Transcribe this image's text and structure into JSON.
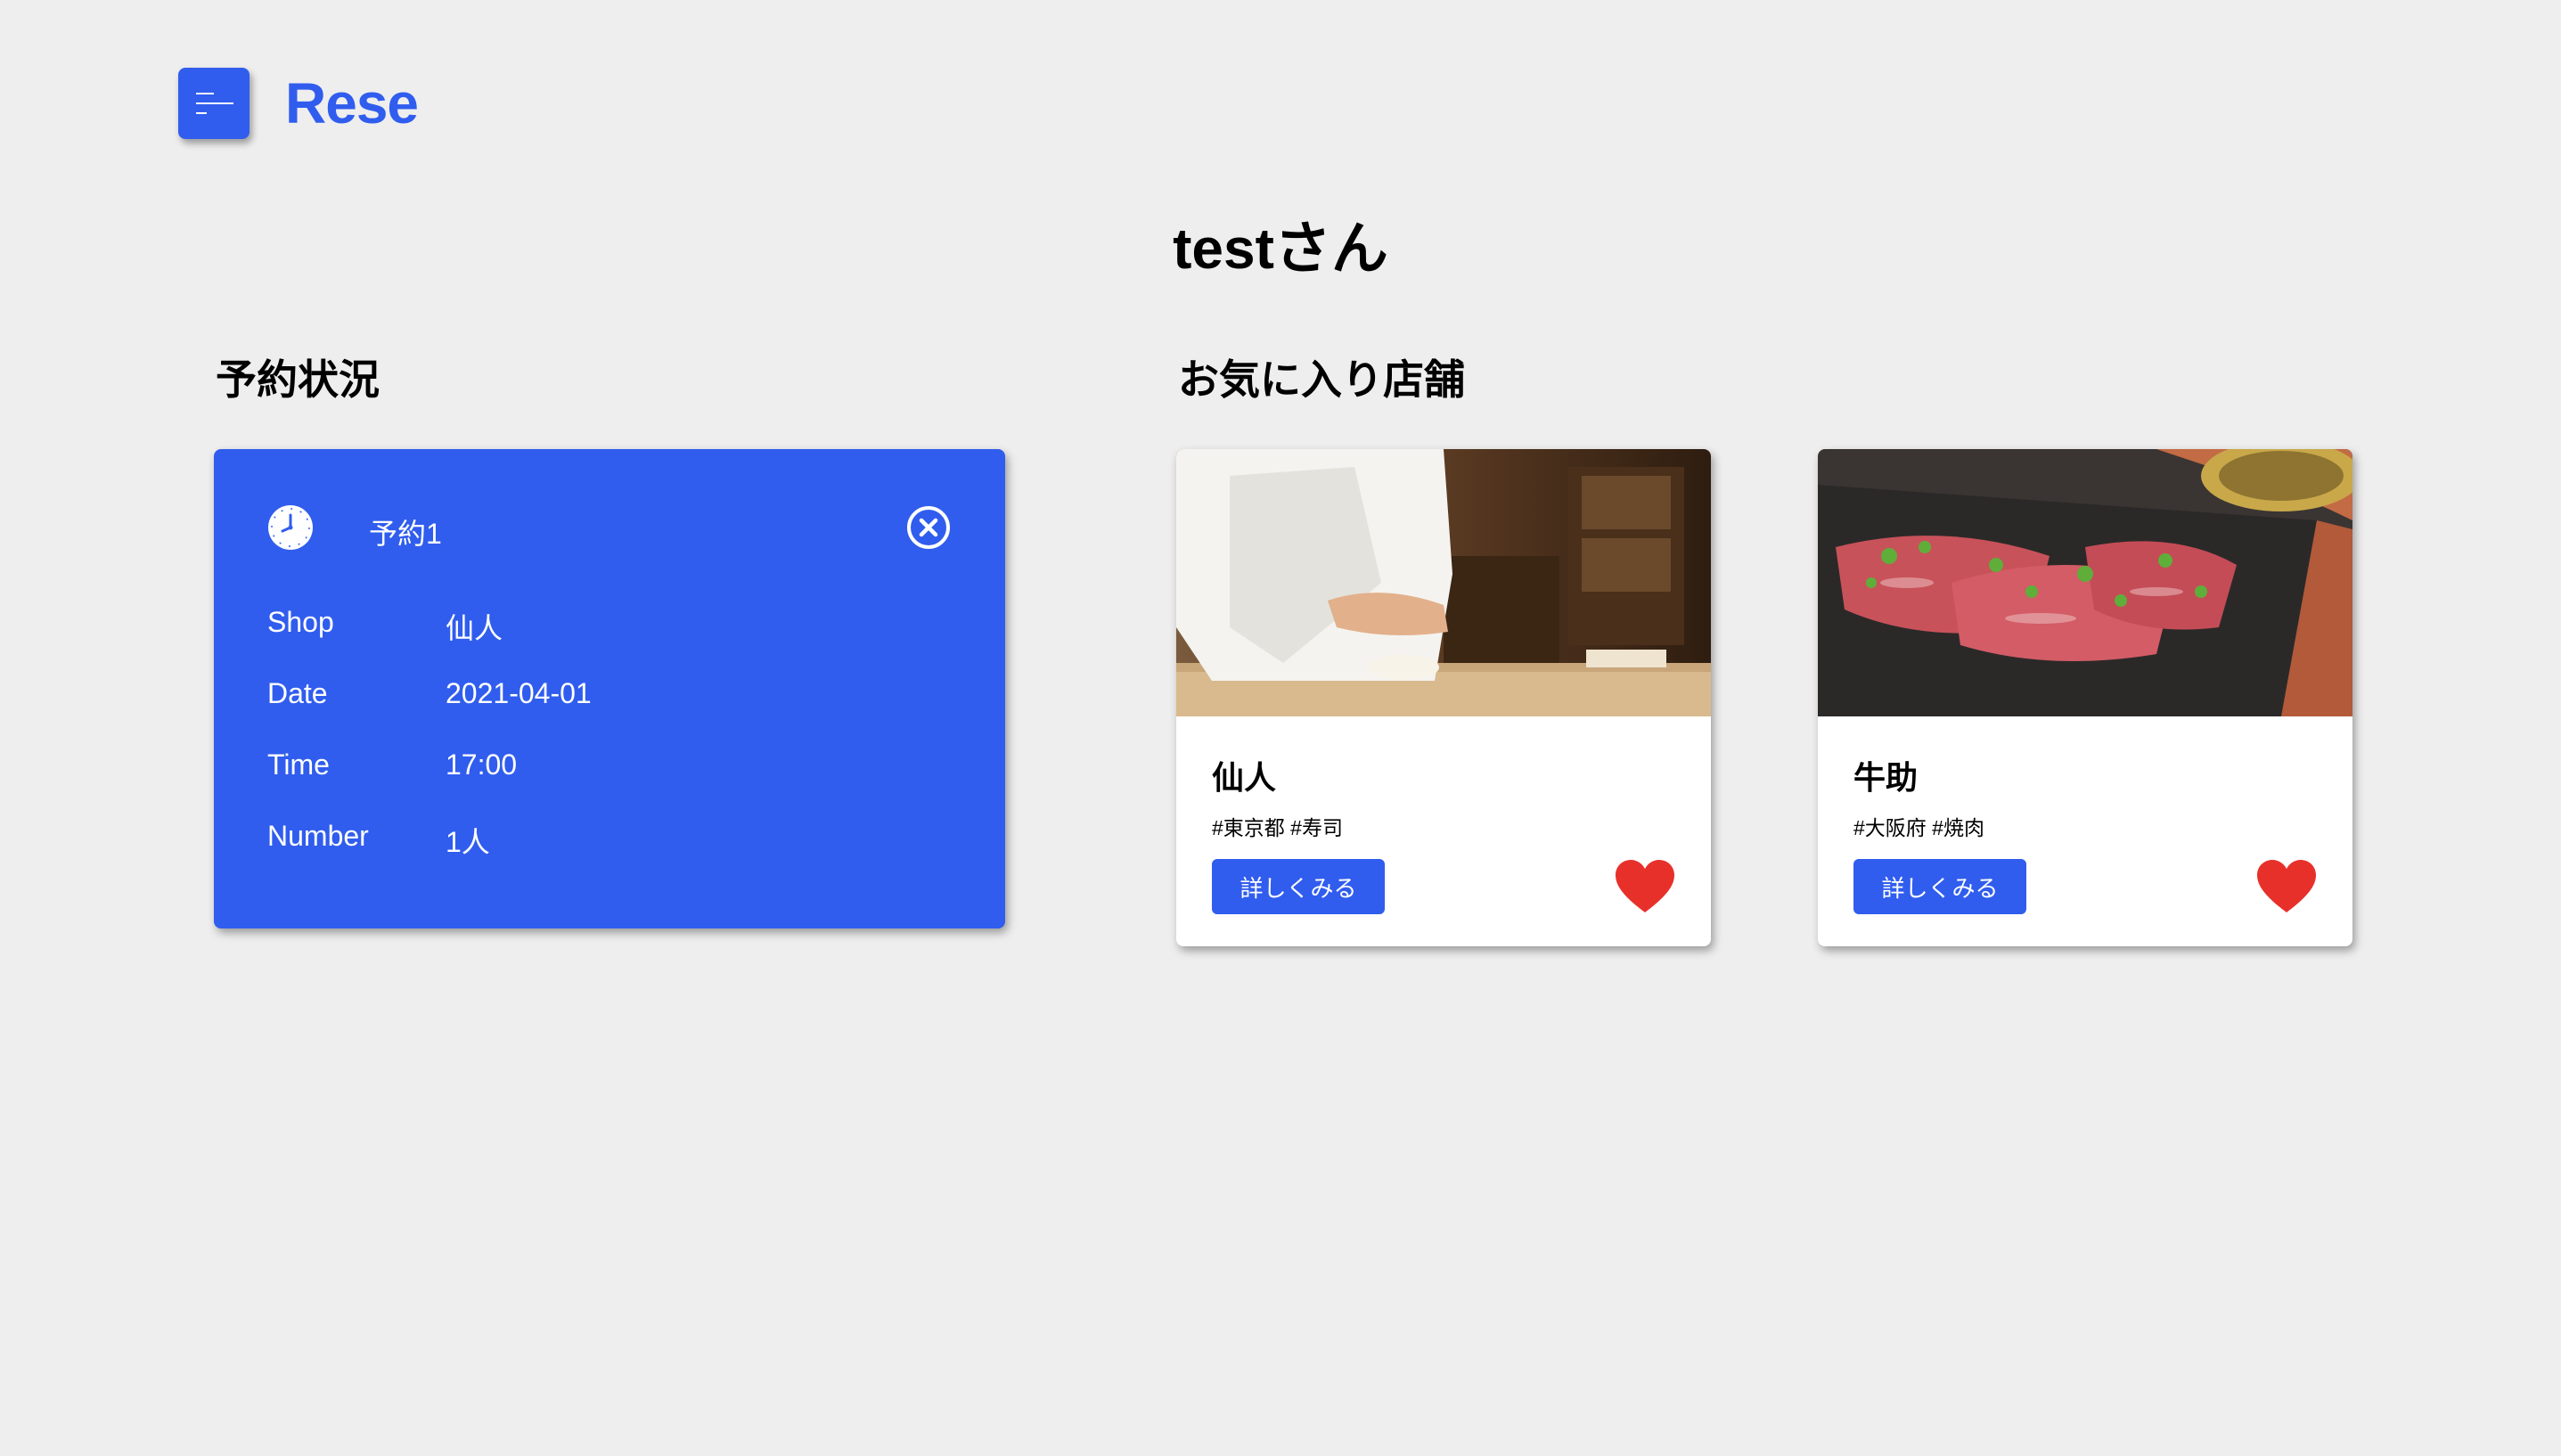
{
  "header": {
    "logo": "Rese",
    "menu_icon": "hamburger-menu-icon",
    "accent_color": "#305dee"
  },
  "greeting": "testさん",
  "reservations": {
    "title": "予約状況",
    "items": [
      {
        "name": "予約1",
        "icon": "clock-icon",
        "close_icon": "cancel-circle-icon",
        "fields": [
          {
            "label": "Shop",
            "value": "仙人"
          },
          {
            "label": "Date",
            "value": "2021-04-01"
          },
          {
            "label": "Time",
            "value": "17:00"
          },
          {
            "label": "Number",
            "value": "1人"
          }
        ]
      }
    ]
  },
  "favorites": {
    "title": "お気に入り店舗",
    "shops": [
      {
        "name": "仙人",
        "tags": "#東京都 #寿司",
        "button": "詳しくみる",
        "image": "sushi-chef-photo",
        "heart_icon": "heart-icon",
        "heart_color": "#e8302a"
      },
      {
        "name": "牛助",
        "tags": "#大阪府 #焼肉",
        "button": "詳しくみる",
        "image": "yakiniku-meat-photo",
        "heart_icon": "heart-icon",
        "heart_color": "#e8302a"
      }
    ]
  }
}
